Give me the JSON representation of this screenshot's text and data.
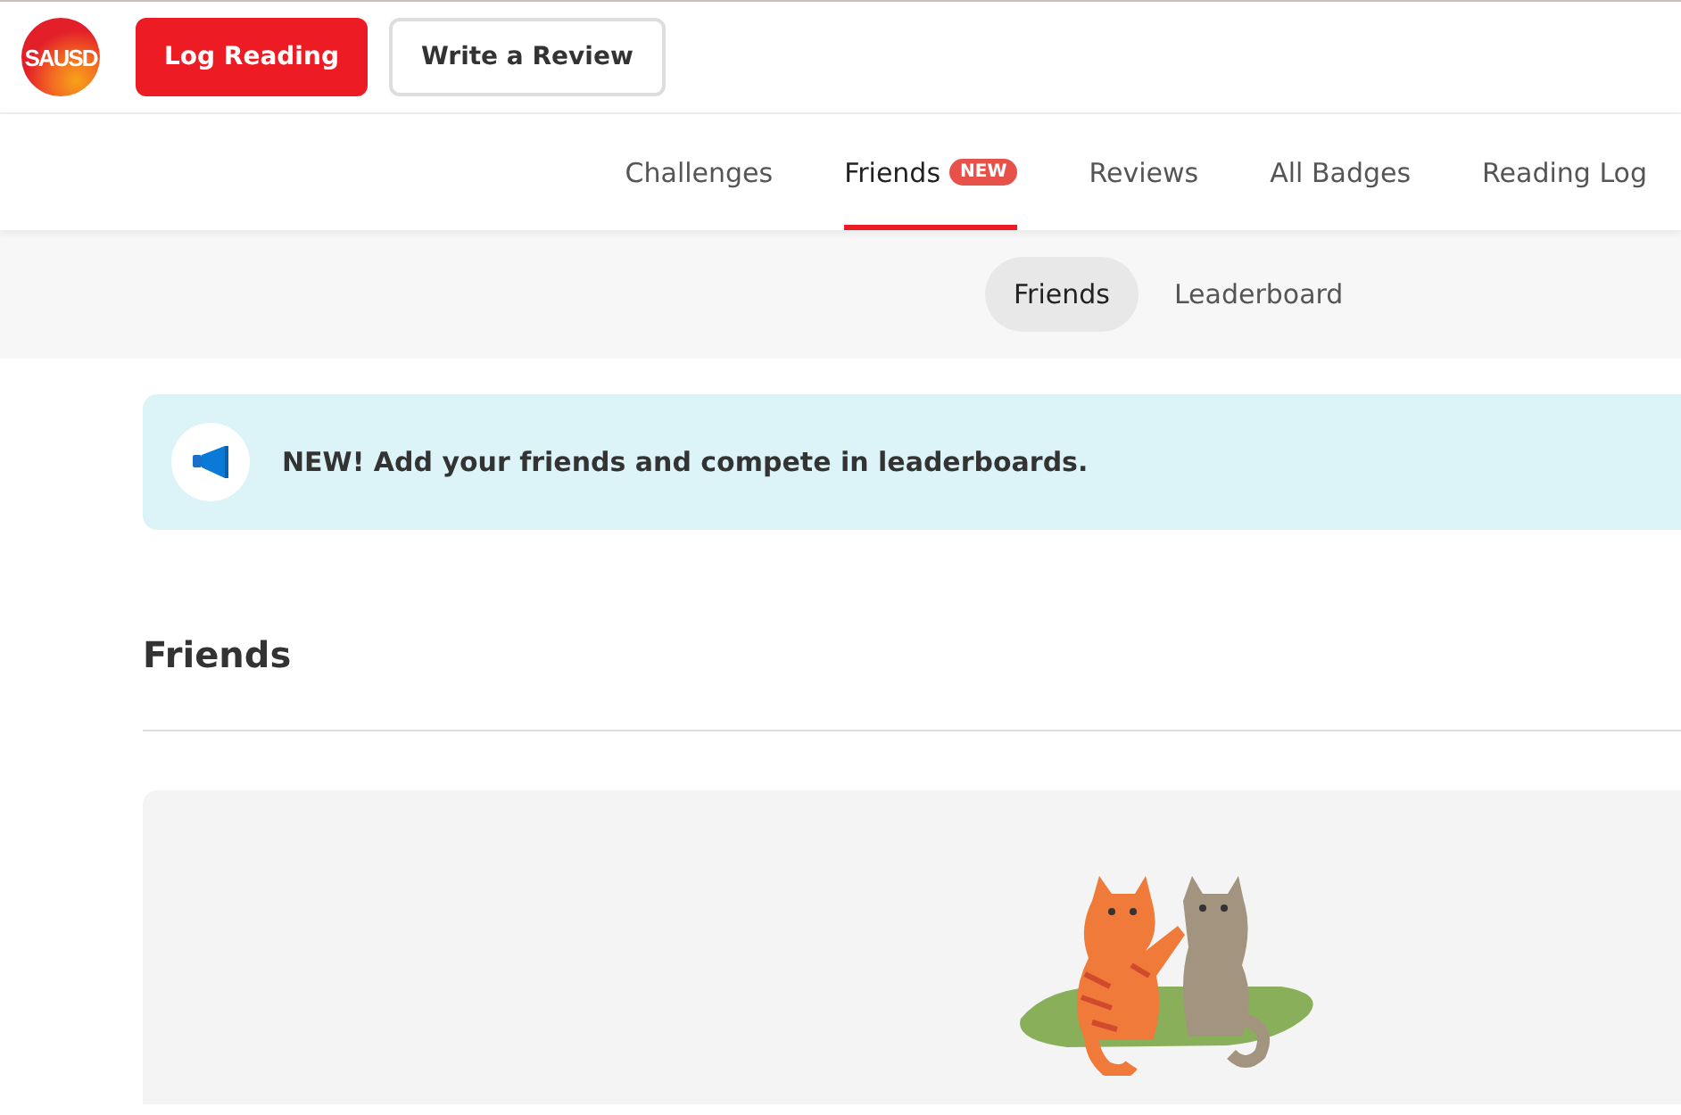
{
  "header": {
    "logo_text": "SAUSD",
    "buttons": [
      {
        "label": "Log Reading",
        "kind": "primary"
      },
      {
        "label": "Write a Review",
        "kind": "secondary"
      }
    ]
  },
  "nav": {
    "tabs": [
      {
        "label": "Challenges",
        "selected": false
      },
      {
        "label": "Friends",
        "selected": true,
        "badge": "NEW"
      },
      {
        "label": "Reviews",
        "selected": false
      },
      {
        "label": "All Badges",
        "selected": false
      },
      {
        "label": "Reading Log",
        "selected": false
      }
    ]
  },
  "subnav": {
    "tabs": [
      {
        "label": "Friends",
        "selected": true
      },
      {
        "label": "Leaderboard",
        "selected": false
      }
    ]
  },
  "banner": {
    "text": "NEW! Add your friends and compete in leaderboards."
  },
  "section": {
    "title": "Friends"
  }
}
